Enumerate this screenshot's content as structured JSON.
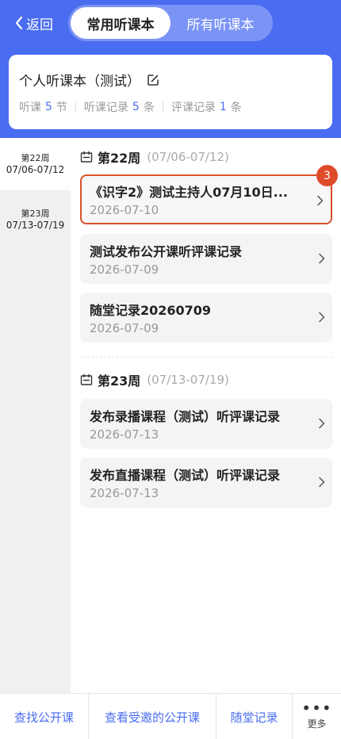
{
  "header": {
    "back_label": "返回",
    "tabs": [
      {
        "label": "常用听课本",
        "active": true
      },
      {
        "label": "所有听课本",
        "active": false
      }
    ],
    "accent_color": "#4a6cf0"
  },
  "notebook": {
    "title": "个人听课本（测试）",
    "edit_icon": "edit-icon",
    "stats": [
      {
        "label": "听课",
        "value": "5",
        "unit": "节"
      },
      {
        "label": "听课记录",
        "value": "5",
        "unit": "条"
      },
      {
        "label": "评课记录",
        "value": "1",
        "unit": "条"
      }
    ]
  },
  "sidebar": {
    "items": [
      {
        "week": "第22周",
        "range": "07/06-07/12",
        "active": true
      },
      {
        "week": "第23周",
        "range": "07/13-07/19",
        "active": false
      }
    ]
  },
  "weeks": [
    {
      "name": "第22周",
      "range": "(07/06-07/12)",
      "records": [
        {
          "title": "《识字2》测试主持人07月10日...",
          "date": "2026-07-10",
          "badge": "3",
          "highlight": true
        },
        {
          "title": "测试发布公开课听评课记录",
          "date": "2026-07-09"
        },
        {
          "title": "随堂记录20260709",
          "date": "2026-07-09"
        }
      ]
    },
    {
      "name": "第23周",
      "range": "(07/13-07/19)",
      "records": [
        {
          "title": "发布录播课程（测试）听评课记录",
          "date": "2026-07-13"
        },
        {
          "title": "发布直播课程（测试）听评课记录",
          "date": "2026-07-13"
        }
      ]
    }
  ],
  "bottom_bar": {
    "find_label": "查找公开课",
    "invited_label": "查看受邀的公开课",
    "random_label": "随堂记录",
    "more_label": "更多",
    "more_icon": "more-dots-icon"
  }
}
